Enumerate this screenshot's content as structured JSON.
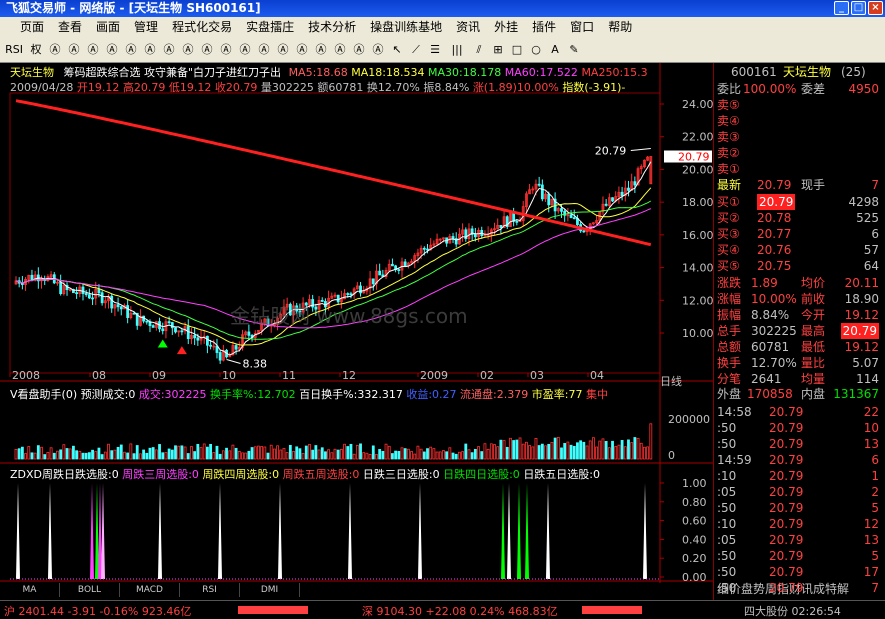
{
  "window": {
    "title": "飞狐交易师 - 网络版 - [天坛生物  SH600161]",
    "min": "_",
    "max": "□",
    "close": "×"
  },
  "menu": [
    "页面",
    "查看",
    "画面",
    "管理",
    "程式化交易",
    "实盘擂庄",
    "技术分析",
    "操盘训练基地",
    "资讯",
    "外挂",
    "插件",
    "窗口",
    "帮助"
  ],
  "toolbar": [
    "RSI",
    "权",
    "Ⓐ",
    "Ⓐ",
    "Ⓐ",
    "Ⓐ",
    "Ⓐ",
    "Ⓐ",
    "Ⓐ",
    "Ⓐ",
    "Ⓐ",
    "Ⓐ",
    "Ⓐ",
    "Ⓐ",
    "Ⓐ",
    "Ⓐ",
    "Ⓐ",
    "Ⓐ",
    "Ⓐ",
    "Ⓐ",
    "↖",
    "⟋",
    "☰",
    "|||",
    "⫽",
    "⊞",
    "□",
    "○",
    "A",
    "✎"
  ],
  "main_header": {
    "stock": "天坛生物",
    "indicator": "筹码超跌综合选  攻守兼备\"白刀子进红刀子出",
    "ma5": "MA5:18.68",
    "ma18": "MA18:18.534",
    "ma30": "MA30:18.178",
    "ma60": "MA60:17.522",
    "ma250": "MA250:15.3"
  },
  "day_info": {
    "date": "2009/04/28",
    "open": "开19.12",
    "high": "高20.79",
    "low": "低19.12",
    "close": "收20.79",
    "vol": "量302225",
    "amount": "额60781",
    "turnover": "换12.70%",
    "amplitude": "振8.84%",
    "rise": "涨(1.89)10.00%",
    "index": "指数(-3.91)-"
  },
  "price_axis": [
    "24.00",
    "22.00",
    "20.00",
    "18.00",
    "16.00",
    "14.00",
    "12.00",
    "10.00"
  ],
  "last_price_label": "20.79",
  "peak_label": "20.79",
  "low_label": "8.38",
  "watermark": "金钻股网 www.88gs.com",
  "x_axis": [
    "2008",
    "08",
    "09",
    "10",
    "11",
    "12",
    "2009",
    "02",
    "03",
    "04"
  ],
  "period": "日线",
  "vol_header": {
    "title": "V看盘助手(0)",
    "forecast": "预测成交:0",
    "vol": "成交:302225",
    "turn": "换手率%:12.702",
    "bai": "百日换手%:332.317",
    "eps": "收益:0.27",
    "float": "流通盘:2.379",
    "pe": "市盈率:77",
    "conc": "集中"
  },
  "vol_axis": [
    "200000",
    "0"
  ],
  "zdxd_header": {
    "t0": "ZDXD周跌日跌选股:0",
    "t1": "周跌三周选股:0",
    "t2": "周跌四周选股:0",
    "t3": "周跌五周选股:0",
    "t4": "日跌三日选股:0",
    "t5": "日跌四日选股:0",
    "t6": "日跌五日选股:0"
  },
  "zdxd_axis": [
    "1.00",
    "0.80",
    "0.60",
    "0.40",
    "0.20",
    "0.00"
  ],
  "tabs": [
    "MA",
    "BOLL",
    "MACD",
    "RSI",
    "DMI"
  ],
  "panel": {
    "code": "600161",
    "name": "天坛生物",
    "count": "(25)",
    "weibi_label": "委比",
    "weibi_val": "100.00%",
    "weicha_label": "委差",
    "weicha_val": "4950",
    "sells": [
      {
        "label": "卖⑤",
        "price": "",
        "vol": ""
      },
      {
        "label": "卖④",
        "price": "",
        "vol": ""
      },
      {
        "label": "卖③",
        "price": "",
        "vol": ""
      },
      {
        "label": "卖②",
        "price": "",
        "vol": ""
      },
      {
        "label": "卖①",
        "price": "",
        "vol": ""
      }
    ],
    "latest_label": "最新",
    "latest_price": "20.79",
    "xianshou_label": "现手",
    "xianshou_val": "7",
    "buys": [
      {
        "label": "买①",
        "price": "20.79",
        "vol": "4298"
      },
      {
        "label": "买②",
        "price": "20.78",
        "vol": "525"
      },
      {
        "label": "买③",
        "price": "20.77",
        "vol": "6"
      },
      {
        "label": "买④",
        "price": "20.76",
        "vol": "57"
      },
      {
        "label": "买⑤",
        "price": "20.75",
        "vol": "64"
      }
    ],
    "stats": [
      {
        "l1": "涨跌",
        "v1": "1.89",
        "c1": "red",
        "l2": "均价",
        "v2": "20.11",
        "c2": "red"
      },
      {
        "l1": "涨幅",
        "v1": "10.00%",
        "c1": "red",
        "l2": "前收",
        "v2": "18.90",
        "c2": "gray"
      },
      {
        "l1": "振幅",
        "v1": "8.84%",
        "c1": "gray",
        "l2": "今开",
        "v2": "19.12",
        "c2": "red"
      },
      {
        "l1": "总手",
        "v1": "302225",
        "c1": "gray",
        "l2": "最高",
        "v2": "20.79",
        "c2": "redbox"
      },
      {
        "l1": "总额",
        "v1": "60781",
        "c1": "gray",
        "l2": "最低",
        "v2": "19.12",
        "c2": "red"
      },
      {
        "l1": "换手",
        "v1": "12.70%",
        "c1": "gray",
        "l2": "量比",
        "v2": "5.07",
        "c2": "gray"
      },
      {
        "l1": "分笔",
        "v1": "2641",
        "c1": "gray",
        "l2": "均量",
        "v2": "114",
        "c2": "gray"
      }
    ],
    "outer_label": "外盘",
    "outer_val": "170858",
    "inner_label": "内盘",
    "inner_val": "131367",
    "ticks": [
      {
        "t": "14:58",
        "p": "20.79",
        "v": "22"
      },
      {
        "t": ":50",
        "p": "20.79",
        "v": "10"
      },
      {
        "t": ":50",
        "p": "20.79",
        "v": "13"
      },
      {
        "t": "14:59",
        "p": "20.79",
        "v": "6"
      },
      {
        "t": ":10",
        "p": "20.79",
        "v": "1"
      },
      {
        "t": ":05",
        "p": "20.79",
        "v": "2"
      },
      {
        "t": ":50",
        "p": "20.79",
        "v": "5"
      },
      {
        "t": ":10",
        "p": "20.79",
        "v": "12"
      },
      {
        "t": ":05",
        "p": "20.79",
        "v": "13"
      },
      {
        "t": ":50",
        "p": "20.79",
        "v": "5"
      },
      {
        "t": ":50",
        "p": "20.79",
        "v": "17"
      },
      {
        "t": ":50",
        "p": "20.79",
        "v": "7"
      }
    ],
    "bottom_tabs": "细价盘势周指财讯成特解"
  },
  "status": {
    "sh": "沪 2401.44 -3.91 -0.16% 923.46亿",
    "sz": "深 9104.30 +22.08 0.24% 468.83亿",
    "right": "四大股份  02:26:54"
  }
}
